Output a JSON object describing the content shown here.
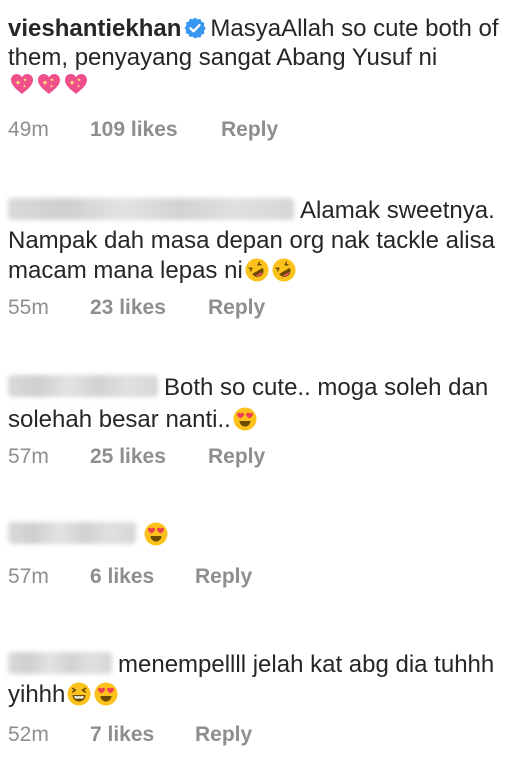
{
  "comments": [
    {
      "username": "vieshantiekhan",
      "verified": true,
      "text": "MasyaAllah so cute both of them, penyayang sangat Abang Yusuf ni",
      "emojis": [
        "sparkling-heart-icon",
        "sparkling-heart-icon",
        "sparkling-heart-icon"
      ],
      "time": "49m",
      "likes": "109 likes",
      "reply": "Reply"
    },
    {
      "username": "",
      "verified": false,
      "text": "Alamak sweetnya. Nampak dah masa depan org nak tackle alisa macam mana lepas ni",
      "emojis": [
        "rolling-laughing-face-icon",
        "rolling-laughing-face-icon"
      ],
      "time": "55m",
      "likes": "23 likes",
      "reply": "Reply"
    },
    {
      "username": "",
      "verified": false,
      "text": "Both so cute.. moga soleh dan solehah besar nanti..",
      "emojis": [
        "heart-eyes-face-icon"
      ],
      "time": "57m",
      "likes": "25 likes",
      "reply": "Reply"
    },
    {
      "username": "",
      "verified": false,
      "text": "",
      "emojis": [
        "heart-eyes-face-icon"
      ],
      "time": "57m",
      "likes": "6 likes",
      "reply": "Reply"
    },
    {
      "username": "",
      "verified": false,
      "text": "menempellll jelah kat abg dia tuhhh yihhh",
      "emojis": [
        "grinning-squinting-face-icon",
        "heart-eyes-face-icon"
      ],
      "time": "52m",
      "likes": "7 likes",
      "reply": "Reply"
    }
  ],
  "colors": {
    "text": "#262626",
    "meta": "#8e8e8e",
    "verified": "#3897f0",
    "emoji_yellow": "#fcc21b",
    "heart_pink": "#ef4f8b"
  }
}
